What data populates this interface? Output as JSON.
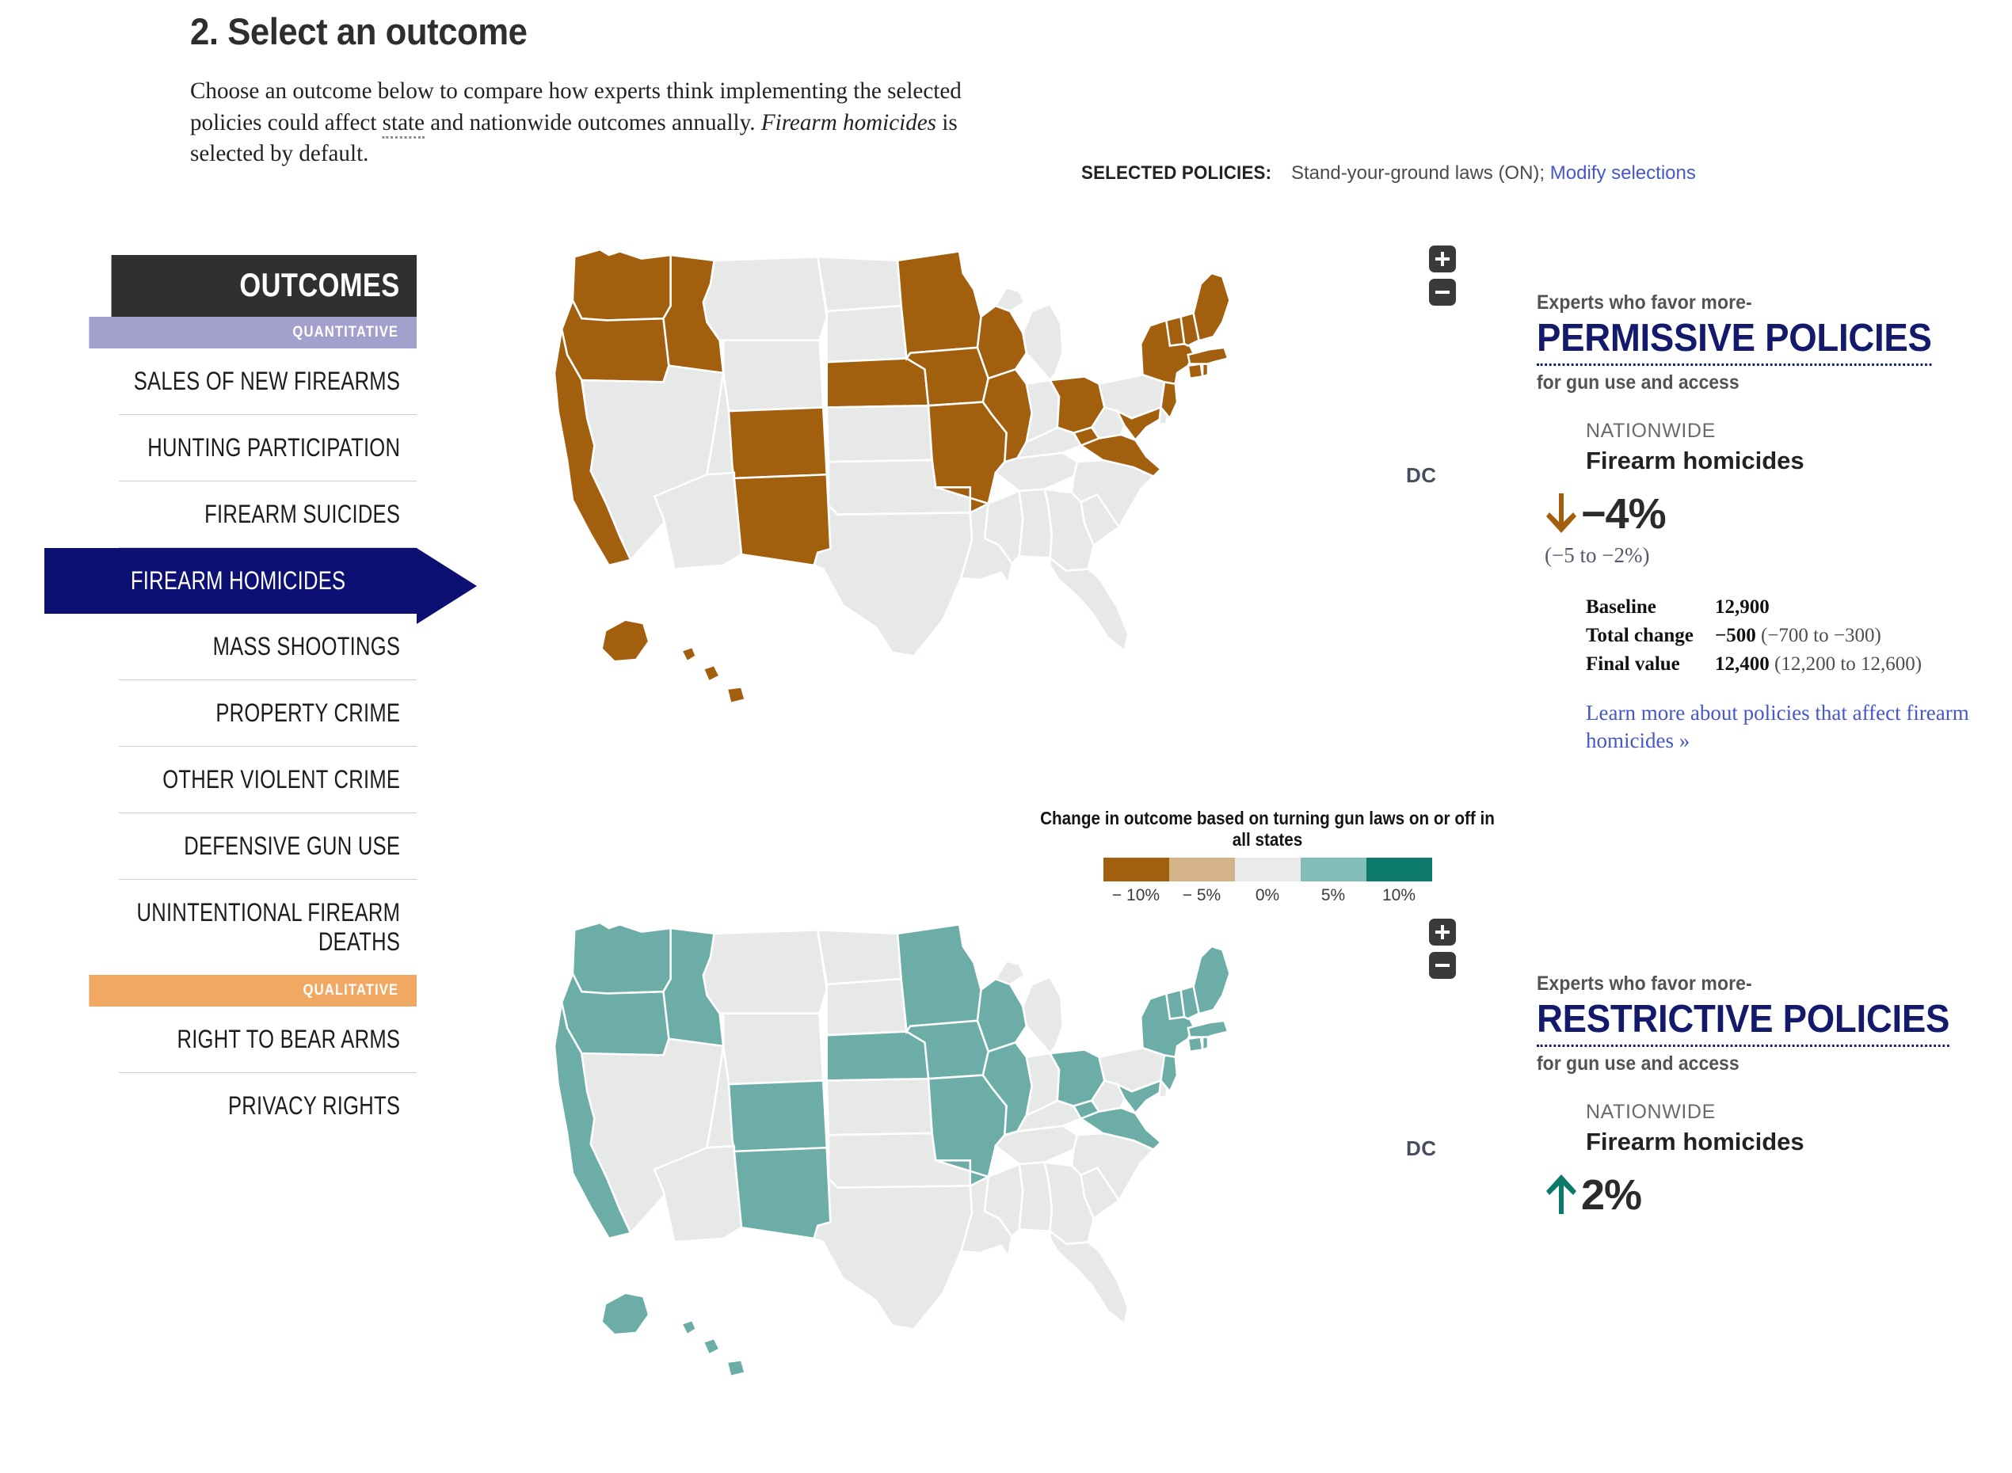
{
  "header": {
    "title": "2. Select an outcome",
    "intro_1": "Choose an outcome below to compare how experts think implementing the selected policies could affect ",
    "intro_dotted": "state",
    "intro_2": " and nationwide outcomes annually. ",
    "intro_em": "Firearm homicides",
    "intro_3": " is selected by default."
  },
  "selected_policies": {
    "label": "SELECTED POLICIES:",
    "value": "Stand-your-ground laws (ON);",
    "link": "Modify selections"
  },
  "sidebar": {
    "heading": "OUTCOMES",
    "band_quantitative": "QUANTITATIVE",
    "band_qualitative": "QUALITATIVE",
    "quantitative_items": [
      "SALES OF NEW FIREARMS",
      "HUNTING PARTICIPATION",
      "FIREARM SUICIDES",
      "FIREARM HOMICIDES",
      "MASS SHOOTINGS",
      "PROPERTY CRIME",
      "OTHER VIOLENT CRIME",
      "DEFENSIVE GUN USE",
      "UNINTENTIONAL FIREARM DEATHS"
    ],
    "active_item": "FIREARM HOMICIDES",
    "qualitative_items": [
      "RIGHT TO BEAR ARMS",
      "PRIVACY RIGHTS"
    ]
  },
  "maps": {
    "dc_label": "DC",
    "zoom_in": "+",
    "zoom_out": "−",
    "permissive_fill": "#a2600f",
    "restrictive_fill": "#6cada7",
    "neutral_fill": "#e7e8e8",
    "highlighted_states": [
      "WA",
      "OR",
      "CA",
      "ID",
      "CO",
      "NM",
      "MN",
      "IA",
      "WI",
      "IL",
      "MO",
      "AR",
      "NE",
      "OH",
      "VA",
      "MD",
      "NJ",
      "NY",
      "CT",
      "RI",
      "MA",
      "VT",
      "NH",
      "ME",
      "HI",
      "AK"
    ]
  },
  "legend": {
    "title": "Change in outcome based on turning gun laws on or off in all states",
    "colors": [
      "#a2600f",
      "#d5b389",
      "#eaeaea",
      "#84bdb7",
      "#0c7a6b"
    ],
    "ticks": [
      "− 10%",
      "− 5%",
      "0%",
      "5%",
      "10%"
    ]
  },
  "panels": [
    {
      "eyebrow": "Experts who favor more-",
      "title": "PERMISSIVE POLICIES",
      "sub": "for gun use and access",
      "nationwide": "NATIONWIDE",
      "outcome": "Firearm homicides",
      "direction": "down",
      "arrow_color": "#a2600f",
      "percent": "−4%",
      "range": "(−5 to −2%)",
      "stats": [
        {
          "key": "Baseline",
          "value": "12,900",
          "range": ""
        },
        {
          "key": "Total change",
          "value": "−500",
          "range": "(−700 to −300)"
        },
        {
          "key": "Final value",
          "value": "12,400",
          "range": "(12,200 to 12,600)"
        }
      ],
      "learn_more": "Learn more about policies that affect firearm homicides »"
    },
    {
      "eyebrow": "Experts who favor more-",
      "title": "RESTRICTIVE POLICIES",
      "sub": "for gun use and access",
      "nationwide": "NATIONWIDE",
      "outcome": "Firearm homicides",
      "direction": "up",
      "arrow_color": "#0c7a6b",
      "percent": "2%",
      "range": "",
      "stats": [],
      "learn_more": ""
    }
  ]
}
